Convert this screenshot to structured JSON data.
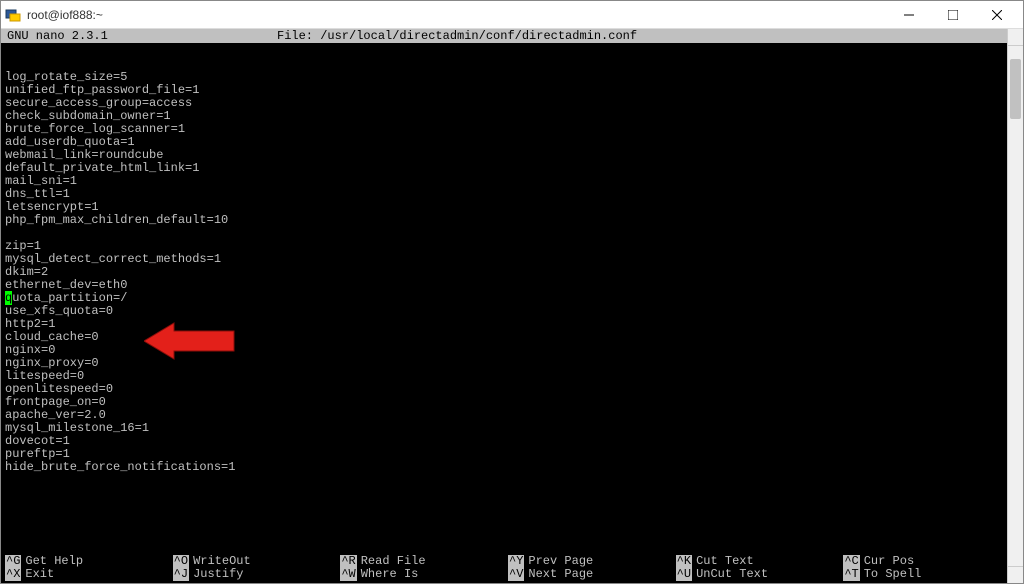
{
  "window": {
    "title": "root@iof888:~"
  },
  "nano": {
    "version": "GNU nano 2.3.1",
    "file_label": "File: /usr/local/directadmin/conf/directadmin.conf"
  },
  "config_lines": [
    "",
    "",
    "log_rotate_size=5",
    "unified_ftp_password_file=1",
    "secure_access_group=access",
    "check_subdomain_owner=1",
    "brute_force_log_scanner=1",
    "add_userdb_quota=1",
    "webmail_link=roundcube",
    "default_private_html_link=1",
    "mail_sni=1",
    "dns_ttl=1",
    "letsencrypt=1",
    "php_fpm_max_children_default=10",
    "",
    "zip=1",
    "mysql_detect_correct_methods=1",
    "dkim=2",
    "ethernet_dev=eth0",
    "quota_partition=/",
    "use_xfs_quota=0",
    "http2=1",
    "cloud_cache=0",
    "nginx=0",
    "nginx_proxy=0",
    "litespeed=0",
    "openlitespeed=0",
    "frontpage_on=0",
    "apache_ver=2.0",
    "mysql_milestone_16=1",
    "dovecot=1",
    "pureftp=1",
    "hide_brute_force_notifications=1"
  ],
  "cursor_line_index": 19,
  "shortcuts": [
    {
      "key": "^G",
      "label": "Get Help"
    },
    {
      "key": "^O",
      "label": "WriteOut"
    },
    {
      "key": "^R",
      "label": "Read File"
    },
    {
      "key": "^Y",
      "label": "Prev Page"
    },
    {
      "key": "^K",
      "label": "Cut Text"
    },
    {
      "key": "^C",
      "label": "Cur Pos"
    },
    {
      "key": "^X",
      "label": "Exit"
    },
    {
      "key": "^J",
      "label": "Justify"
    },
    {
      "key": "^W",
      "label": "Where Is"
    },
    {
      "key": "^V",
      "label": "Next Page"
    },
    {
      "key": "^U",
      "label": "UnCut Text"
    },
    {
      "key": "^T",
      "label": "To Spell"
    }
  ]
}
